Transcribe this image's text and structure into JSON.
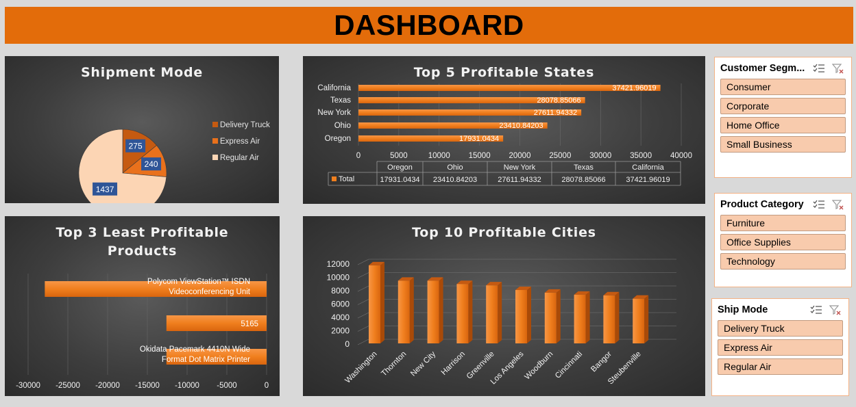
{
  "dashboard": {
    "title": "DASHBOARD"
  },
  "shipment_mode": {
    "title": "Shipment Mode",
    "legend": [
      "Delivery Truck",
      "Express Air",
      "Regular Air"
    ],
    "labels": [
      "275",
      "240",
      "1437"
    ]
  },
  "top_states": {
    "title": "Top 5 Profitable States",
    "total_label": "Total"
  },
  "least_products": {
    "title_line1": "Top 3 Least Profitable",
    "title_line2": "Products"
  },
  "top_cities": {
    "title": "Top 10 Profitable Cities"
  },
  "slicers": {
    "customer_segment": {
      "title": "Customer Segm...",
      "items": [
        "Consumer",
        "Corporate",
        "Home Office",
        "Small Business"
      ]
    },
    "product_category": {
      "title": "Product Category",
      "items": [
        "Furniture",
        "Office Supplies",
        "Technology"
      ]
    },
    "ship_mode": {
      "title": "Ship Mode",
      "items": [
        "Delivery Truck",
        "Express Air",
        "Regular Air"
      ]
    }
  },
  "colors": {
    "accent": "#e36c0a",
    "bar": "#f07f1e",
    "pie_light": "#fcd5b4",
    "pie_dark": "#c55a11",
    "pie_mid": "#e9711c",
    "label_box": "#2f5597"
  },
  "chart_data": [
    {
      "type": "pie",
      "title": "Shipment Mode",
      "categories": [
        "Delivery Truck",
        "Express Air",
        "Regular Air"
      ],
      "values": [
        275,
        240,
        1437
      ]
    },
    {
      "type": "bar",
      "orientation": "horizontal",
      "title": "Top 5 Profitable States",
      "categories": [
        "California",
        "Texas",
        "New York",
        "Ohio",
        "Oregon"
      ],
      "values": [
        37421.96019,
        28078.85066,
        27611.94332,
        23410.84203,
        17931.0434
      ],
      "value_labels": [
        "37421.96019",
        "28078.85066",
        "27611.94332",
        "23410.84203",
        "17931.0434"
      ],
      "xlim": [
        0,
        40000
      ],
      "xticks": [
        "0",
        "5000",
        "10000",
        "15000",
        "20000",
        "25000",
        "30000",
        "35000",
        "40000"
      ],
      "table": {
        "columns": [
          "Oregon",
          "Ohio",
          "New York",
          "Texas",
          "California"
        ],
        "row_label": "Total",
        "values": [
          "17931.0434",
          "23410.84203",
          "27611.94332",
          "28078.85066",
          "37421.96019"
        ]
      }
    },
    {
      "type": "bar",
      "orientation": "horizontal",
      "title": "Top 3 Least Profitable Products",
      "categories": [
        "Polycom ViewStation™ ISDN Videoconferencing Unit",
        "5165",
        "Okidata Pacemark 4410N Wide Format Dot Matrix Printer"
      ],
      "values": [
        -27900,
        -12600,
        -12600
      ],
      "xlim": [
        -30000,
        0
      ],
      "xticks": [
        "-30000",
        "-25000",
        "-20000",
        "-15000",
        "-10000",
        "-5000",
        "0"
      ]
    },
    {
      "type": "bar",
      "title": "Top 10 Profitable Cities",
      "categories": [
        "Washington",
        "Thornton",
        "New City",
        "Harrison",
        "Greenville",
        "Los Angeles",
        "Woodburn",
        "Cincinnati",
        "Bangor",
        "Steubenville"
      ],
      "values": [
        11700,
        9400,
        9400,
        8900,
        8700,
        8000,
        7600,
        7300,
        7200,
        6700
      ],
      "ylim": [
        0,
        12000
      ],
      "yticks": [
        "0",
        "2000",
        "4000",
        "6000",
        "8000",
        "10000",
        "12000"
      ]
    }
  ]
}
